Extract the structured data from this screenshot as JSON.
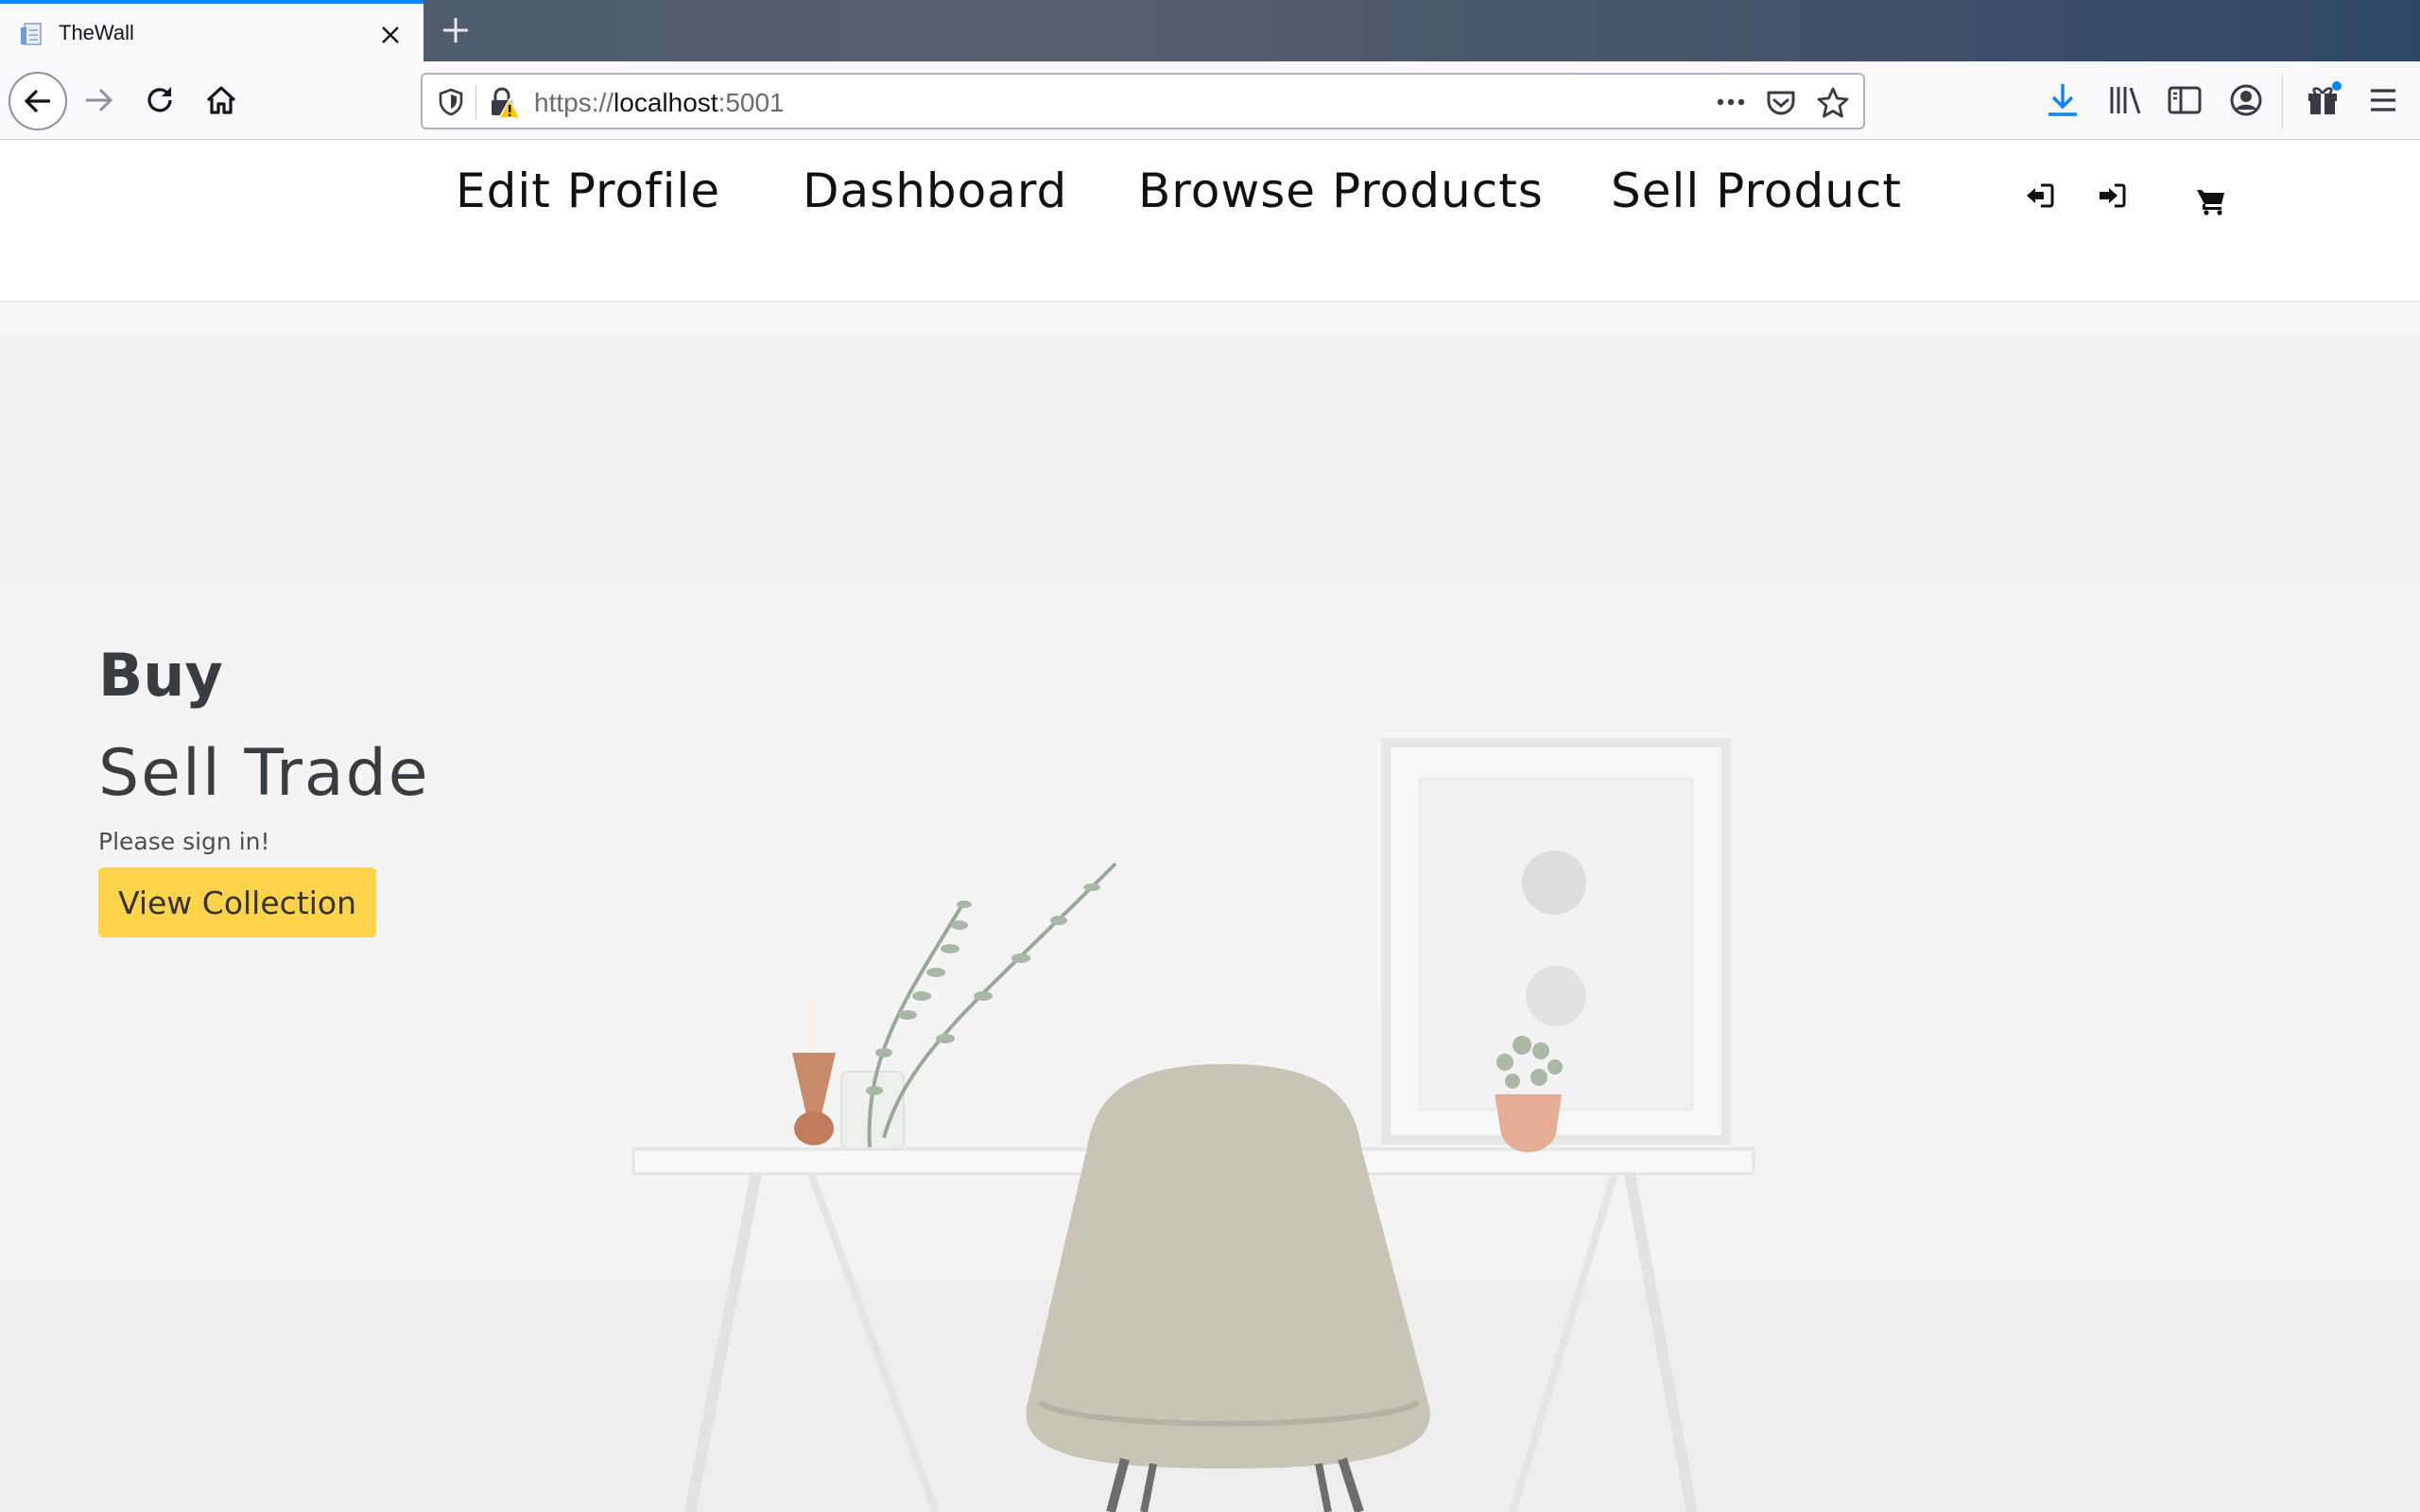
{
  "browser": {
    "tab": {
      "title": "TheWall",
      "favicon": "document-icon"
    },
    "new_tab_icon": "plus-icon",
    "url": {
      "scheme": "https://",
      "host": "localhost",
      "port": ":5001"
    },
    "toolbar_icons": [
      "back-icon",
      "forward-icon",
      "reload-icon",
      "home-icon",
      "tracking-shield-icon",
      "insecure-lock-icon",
      "more-icon",
      "pocket-icon",
      "bookmark-star-icon",
      "download-icon",
      "library-icon",
      "sidebar-icon",
      "account-icon",
      "extension-gift-icon",
      "hamburger-menu-icon"
    ],
    "accent_color": "#0a84ff"
  },
  "site": {
    "nav": {
      "items": [
        {
          "label": "Edit Profile"
        },
        {
          "label": "Dashboard"
        },
        {
          "label": "Browse Products"
        },
        {
          "label": "Sell Product"
        }
      ],
      "icons": [
        "sign-out-icon",
        "sign-in-icon",
        "shopping-cart-icon"
      ]
    },
    "hero": {
      "title": "Buy",
      "subtitle": "Sell Trade",
      "note": "Please sign in!",
      "button": "View Collection",
      "button_color": "#ffd34a"
    }
  }
}
